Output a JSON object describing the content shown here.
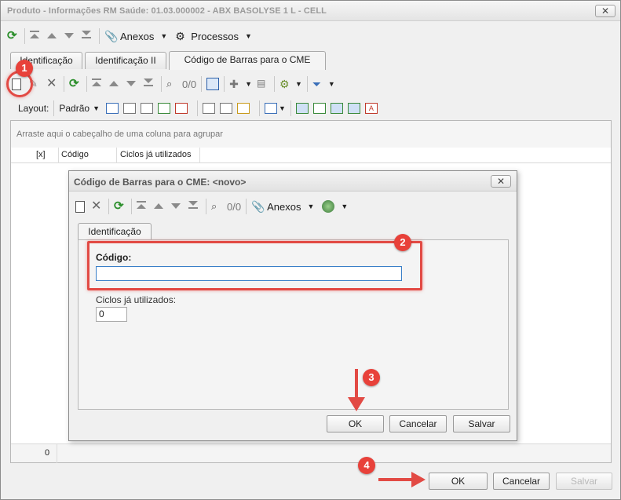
{
  "window": {
    "title": "Produto - Informações RM Saúde: 01.03.000002 - ABX BASOLYSE 1 L - CELL",
    "close_glyph": "✕"
  },
  "main_toolbar": {
    "anexos_label": "Anexos",
    "processos_label": "Processos"
  },
  "tabs": [
    {
      "label": "Identificação"
    },
    {
      "label": "Identificação II"
    },
    {
      "label": "Código de Barras para o CME"
    }
  ],
  "grid_toolbar": {
    "counter": "0/0"
  },
  "layout_bar": {
    "layout_label": "Layout:",
    "padrao_label": "Padrão"
  },
  "grid": {
    "group_hint": "Arraste aqui o cabeçalho de uma coluna para agrupar",
    "columns": [
      "[x]",
      "Código",
      "Ciclos já utilizados"
    ],
    "footer_count": "0"
  },
  "dialog": {
    "title": "Código de Barras para o CME: <novo>",
    "close_glyph": "✕",
    "counter": "0/0",
    "anexos_label": "Anexos",
    "tab_label": "Identificação",
    "codigo_label": "Código:",
    "codigo_value": "",
    "ciclos_label": "Ciclos já utilizados:",
    "ciclos_value": "0",
    "ok_label": "OK",
    "cancelar_label": "Cancelar",
    "salvar_label": "Salvar"
  },
  "footer": {
    "ok_label": "OK",
    "cancelar_label": "Cancelar",
    "salvar_label": "Salvar"
  },
  "markers": [
    "1",
    "2",
    "3",
    "4"
  ],
  "colors": {
    "marker": "#e8413a",
    "refresh_green": "#2c8f2c"
  }
}
